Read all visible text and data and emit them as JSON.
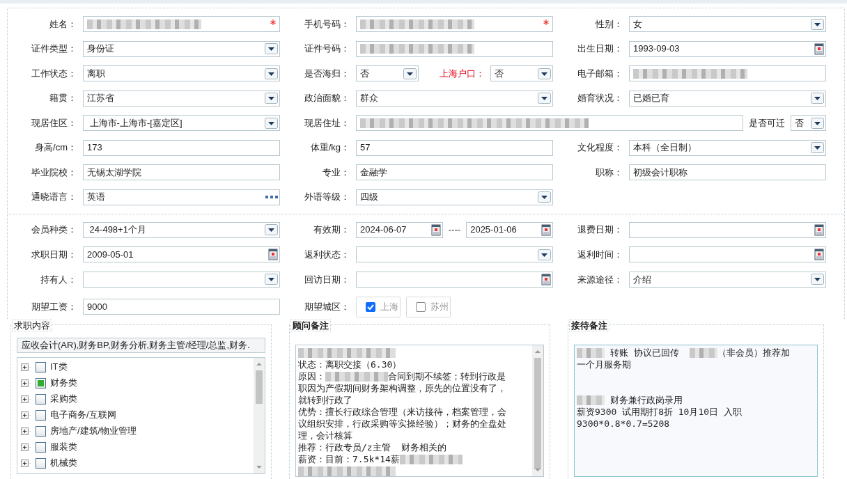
{
  "sections": [
    {
      "rows": [
        [
          {
            "label": "姓名：",
            "controls": [
              {
                "kind": "text",
                "redacted": true,
                "required": true
              }
            ]
          },
          {
            "label": "手机号码：",
            "controls": [
              {
                "kind": "text",
                "redacted": true,
                "required": true
              }
            ]
          },
          {
            "label": "性别：",
            "controls": [
              {
                "kind": "select",
                "value": "女"
              }
            ]
          }
        ],
        [
          {
            "label": "证件类型：",
            "controls": [
              {
                "kind": "select",
                "value": "身份证"
              }
            ]
          },
          {
            "label": "证件号码：",
            "controls": [
              {
                "kind": "text",
                "redacted": true
              }
            ]
          },
          {
            "label": "出生日期：",
            "controls": [
              {
                "kind": "date",
                "value": "1993-09-03"
              }
            ]
          }
        ],
        [
          {
            "label": "工作状态：",
            "controls": [
              {
                "kind": "select",
                "value": "离职"
              }
            ]
          },
          {
            "label": "是否海归：",
            "controls": [
              {
                "kind": "select",
                "value": "否"
              },
              {
                "kind": "label",
                "text": "上海户口：",
                "alert": true
              },
              {
                "kind": "select",
                "value": "否"
              }
            ]
          },
          {
            "label": "电子邮箱：",
            "controls": [
              {
                "kind": "text",
                "redacted": true
              }
            ]
          }
        ],
        [
          {
            "label": "籍贯：",
            "controls": [
              {
                "kind": "select",
                "value": "江苏省"
              }
            ]
          },
          {
            "label": "政治面貌：",
            "controls": [
              {
                "kind": "select",
                "value": "群众"
              }
            ]
          },
          {
            "label": "婚育状况：",
            "controls": [
              {
                "kind": "select",
                "value": "已婚已育"
              }
            ]
          }
        ],
        [
          {
            "label": "现居住区：",
            "controls": [
              {
                "kind": "select",
                "value": " 上海市-上海市-[嘉定区]"
              }
            ]
          },
          {
            "label": "现居住址：",
            "wide": true,
            "controls": [
              {
                "kind": "text",
                "redacted": true
              },
              {
                "kind": "label",
                "text": "是否可迁",
                "alert": false
              },
              {
                "kind": "select",
                "value": "否"
              }
            ]
          }
        ],
        [
          {
            "label": "身高/cm：",
            "controls": [
              {
                "kind": "text",
                "value": "173"
              }
            ]
          },
          {
            "label": "体重/kg：",
            "controls": [
              {
                "kind": "text",
                "value": "57"
              }
            ]
          },
          {
            "label": "文化程度：",
            "controls": [
              {
                "kind": "select",
                "value": "本科（全日制）"
              }
            ]
          }
        ],
        [
          {
            "label": "毕业院校：",
            "controls": [
              {
                "kind": "text",
                "value": "无锡太湖学院"
              }
            ]
          },
          {
            "label": "专业：",
            "controls": [
              {
                "kind": "text",
                "value": "金融学"
              }
            ]
          },
          {
            "label": "职称：",
            "controls": [
              {
                "kind": "text",
                "value": "初级会计职称"
              }
            ]
          }
        ],
        [
          {
            "label": "通晓语言：",
            "controls": [
              {
                "kind": "lookup",
                "value": "英语"
              }
            ]
          },
          {
            "label": "外语等级：",
            "controls": [
              {
                "kind": "select",
                "value": "四级"
              }
            ]
          }
        ]
      ]
    },
    {
      "rows": [
        [
          {
            "label": "会员种类：",
            "controls": [
              {
                "kind": "select",
                "value": " 24-498+1个月"
              }
            ]
          },
          {
            "label": "有效期：",
            "controls": [
              {
                "kind": "date",
                "value": "2024-06-07"
              },
              {
                "kind": "label",
                "text": "----",
                "alert": false
              },
              {
                "kind": "date",
                "value": "2025-01-06"
              }
            ]
          },
          {
            "label": "退费日期：",
            "controls": [
              {
                "kind": "date"
              }
            ]
          }
        ],
        [
          {
            "label": "求职日期：",
            "controls": [
              {
                "kind": "date",
                "value": "2009-05-01"
              }
            ]
          },
          {
            "label": "返利状态：",
            "controls": [
              {
                "kind": "select"
              }
            ]
          },
          {
            "label": "返利时间：",
            "controls": [
              {
                "kind": "date"
              }
            ]
          }
        ],
        [
          {
            "label": "持有人：",
            "controls": [
              {
                "kind": "select"
              }
            ]
          },
          {
            "label": "回访日期：",
            "controls": [
              {
                "kind": "date"
              }
            ]
          },
          {
            "label": "来源途径：",
            "controls": [
              {
                "kind": "select",
                "value": "介绍"
              }
            ]
          }
        ],
        [
          {
            "label": "期望工资：",
            "controls": [
              {
                "kind": "text",
                "value": "9000"
              }
            ]
          },
          {
            "label": "期望城区：",
            "controls": [
              {
                "kind": "checkbutton",
                "text": "上海",
                "checked": true
              },
              {
                "kind": "checkbutton",
                "text": "苏州",
                "checked": false
              }
            ]
          }
        ]
      ]
    }
  ],
  "panels": [
    {
      "kind": "tree",
      "title": "求职内容",
      "summary": "应收会计(AR),财务BP,财务分析,财务主管/经理/总监,财务.",
      "items": [
        {
          "label": "IT类",
          "checked": false
        },
        {
          "label": "财务类",
          "checked": true
        },
        {
          "label": "采购类",
          "checked": false
        },
        {
          "label": "电子商务/互联网",
          "checked": false
        },
        {
          "label": "房地产/建筑/物业管理",
          "checked": false
        },
        {
          "label": "服装类",
          "checked": false
        },
        {
          "label": "机械类",
          "checked": false
        }
      ]
    },
    {
      "kind": "notes",
      "title": "顾问备注",
      "lines": [
        {
          "kind": "text",
          "segments": [
            {
              "kind": "redacted"
            }
          ]
        },
        {
          "kind": "text",
          "segments": [
            {
              "kind": "text",
              "text": "状态：离职交接（6.30）"
            }
          ]
        },
        {
          "kind": "text",
          "segments": [
            {
              "kind": "text",
              "text": "原因："
            },
            {
              "kind": "redacted"
            },
            {
              "kind": "text",
              "text": "合同到期不续签；转到行政是"
            }
          ]
        },
        {
          "kind": "text",
          "segments": [
            {
              "kind": "text",
              "text": "职因为产假期间财务架构调整，原先的位置没有了，"
            }
          ]
        },
        {
          "kind": "text",
          "segments": [
            {
              "kind": "text",
              "text": "就转到行政了"
            }
          ]
        },
        {
          "kind": "text",
          "segments": [
            {
              "kind": "text",
              "text": "优势：擅长行政综合管理（来访接待，档案管理，会"
            }
          ]
        },
        {
          "kind": "text",
          "segments": [
            {
              "kind": "text",
              "text": "议组织安排，行政采购等实操经验）；财务的全盘处"
            }
          ]
        },
        {
          "kind": "text",
          "segments": [
            {
              "kind": "text",
              "text": "理，会计核算"
            }
          ]
        },
        {
          "kind": "text",
          "segments": [
            {
              "kind": "text",
              "text": "推荐：行政专员/z主管  财务相关的"
            }
          ]
        },
        {
          "kind": "text",
          "segments": [
            {
              "kind": "text",
              "text": "薪资：目前：7.5k*14薪"
            },
            {
              "kind": "redacted"
            }
          ]
        },
        {
          "kind": "text",
          "segments": [
            {
              "kind": "redacted"
            }
          ]
        }
      ]
    },
    {
      "kind": "notes",
      "title": "接待备注",
      "lines": [
        {
          "kind": "text",
          "segments": [
            {
              "kind": "redacted"
            },
            {
              "kind": "text",
              "text": " 转账 协议已回传  "
            },
            {
              "kind": "redacted"
            },
            {
              "kind": "text",
              "text": "（非会员）推荐加"
            }
          ]
        },
        {
          "kind": "text",
          "segments": [
            {
              "kind": "text",
              "text": "一个月服务期"
            }
          ]
        },
        {
          "kind": "blank"
        },
        {
          "kind": "blank"
        },
        {
          "kind": "text",
          "segments": [
            {
              "kind": "redacted"
            },
            {
              "kind": "text",
              "text": " 财务兼行政岗录用"
            }
          ]
        },
        {
          "kind": "text",
          "segments": [
            {
              "kind": "text",
              "text": "薪资9300 试用期打8折 10月10日 入职"
            }
          ]
        },
        {
          "kind": "text",
          "segments": [
            {
              "kind": "text",
              "text": "9300*0.8*0.7=5208"
            }
          ]
        }
      ]
    }
  ]
}
